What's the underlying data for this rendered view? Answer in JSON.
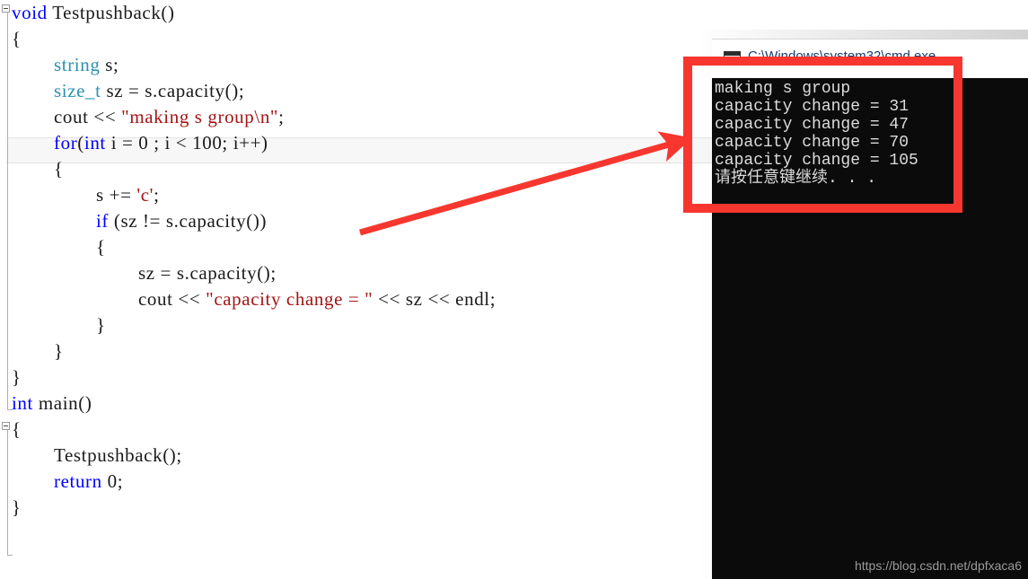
{
  "editor": {
    "highlighted_line_index": 5,
    "colors": {
      "keyword": "#0000ff",
      "type": "#2b91af",
      "string": "#a31515",
      "plain": "#1a1a1a",
      "background": "#ffffff",
      "line_highlight": "#f7f7f7"
    },
    "lines": [
      {
        "indent": 0,
        "collapse_marker": true,
        "tokens": [
          {
            "t": "kw",
            "s": "void"
          },
          {
            "t": "pln",
            "s": " Testpushback()"
          }
        ]
      },
      {
        "indent": 0,
        "collapse_marker": false,
        "tokens": [
          {
            "t": "pln",
            "s": "{"
          }
        ]
      },
      {
        "indent": 1,
        "collapse_marker": false,
        "tokens": [
          {
            "t": "typ",
            "s": "string"
          },
          {
            "t": "pln",
            "s": " s;"
          }
        ]
      },
      {
        "indent": 1,
        "collapse_marker": false,
        "tokens": [
          {
            "t": "typ",
            "s": "size_t"
          },
          {
            "t": "pln",
            "s": " sz = s.capacity();"
          }
        ]
      },
      {
        "indent": 1,
        "collapse_marker": false,
        "tokens": [
          {
            "t": "pln",
            "s": "cout << "
          },
          {
            "t": "str",
            "s": "\"making s group\\n\""
          },
          {
            "t": "pln",
            "s": ";"
          }
        ]
      },
      {
        "indent": 1,
        "collapse_marker": false,
        "tokens": [
          {
            "t": "kw",
            "s": "for"
          },
          {
            "t": "pln",
            "s": "("
          },
          {
            "t": "kw",
            "s": "int"
          },
          {
            "t": "pln",
            "s": " i = 0 ; i < 100; i++)"
          }
        ]
      },
      {
        "indent": 1,
        "collapse_marker": false,
        "tokens": [
          {
            "t": "pln",
            "s": "{"
          }
        ]
      },
      {
        "indent": 2,
        "collapse_marker": false,
        "tokens": [
          {
            "t": "pln",
            "s": "s += "
          },
          {
            "t": "str",
            "s": "'c'"
          },
          {
            "t": "pln",
            "s": ";"
          }
        ]
      },
      {
        "indent": 2,
        "collapse_marker": false,
        "tokens": [
          {
            "t": "kw",
            "s": "if"
          },
          {
            "t": "pln",
            "s": " (sz != s.capacity())"
          }
        ]
      },
      {
        "indent": 2,
        "collapse_marker": false,
        "tokens": [
          {
            "t": "pln",
            "s": "{"
          }
        ]
      },
      {
        "indent": 3,
        "collapse_marker": false,
        "tokens": [
          {
            "t": "pln",
            "s": "sz = s.capacity();"
          }
        ]
      },
      {
        "indent": 3,
        "collapse_marker": false,
        "tokens": [
          {
            "t": "pln",
            "s": "cout << "
          },
          {
            "t": "str",
            "s": "\"capacity change = \""
          },
          {
            "t": "pln",
            "s": " << sz << endl;"
          }
        ]
      },
      {
        "indent": 2,
        "collapse_marker": false,
        "tokens": [
          {
            "t": "pln",
            "s": "}"
          }
        ]
      },
      {
        "indent": 1,
        "collapse_marker": false,
        "tokens": [
          {
            "t": "pln",
            "s": "}"
          }
        ]
      },
      {
        "indent": 0,
        "collapse_marker": false,
        "tokens": [
          {
            "t": "pln",
            "s": "}"
          }
        ]
      },
      {
        "indent": 0,
        "collapse_marker": true,
        "tokens": [
          {
            "t": "kw",
            "s": "int"
          },
          {
            "t": "pln",
            "s": " main()"
          }
        ]
      },
      {
        "indent": 0,
        "collapse_marker": false,
        "tokens": [
          {
            "t": "pln",
            "s": "{"
          }
        ]
      },
      {
        "indent": 1,
        "collapse_marker": false,
        "tokens": [
          {
            "t": "pln",
            "s": "Testpushback();"
          }
        ]
      },
      {
        "indent": 1,
        "collapse_marker": false,
        "tokens": [
          {
            "t": "kw",
            "s": "return"
          },
          {
            "t": "pln",
            "s": " 0;"
          }
        ]
      },
      {
        "indent": 0,
        "collapse_marker": false,
        "tokens": [
          {
            "t": "pln",
            "s": "}"
          }
        ]
      }
    ]
  },
  "console": {
    "title": "C:\\Windows\\system32\\cmd.exe",
    "icon": "console-window-icon",
    "background": "#0b0b0b",
    "text_color": "#dcdcdc",
    "output_lines": [
      "making s group",
      "capacity change = 31",
      "capacity change = 47",
      "capacity change = 70",
      "capacity change = 105",
      "请按任意键继续. . ."
    ]
  },
  "annotations": {
    "rect_color": "#f7372f",
    "arrow_color": "#f7372f",
    "rect_label": "highlight-console-output",
    "arrow_label": "points-from-capacity-check-to-output"
  },
  "watermark": {
    "text": "https://blog.csdn.net/dpfxaca6"
  }
}
